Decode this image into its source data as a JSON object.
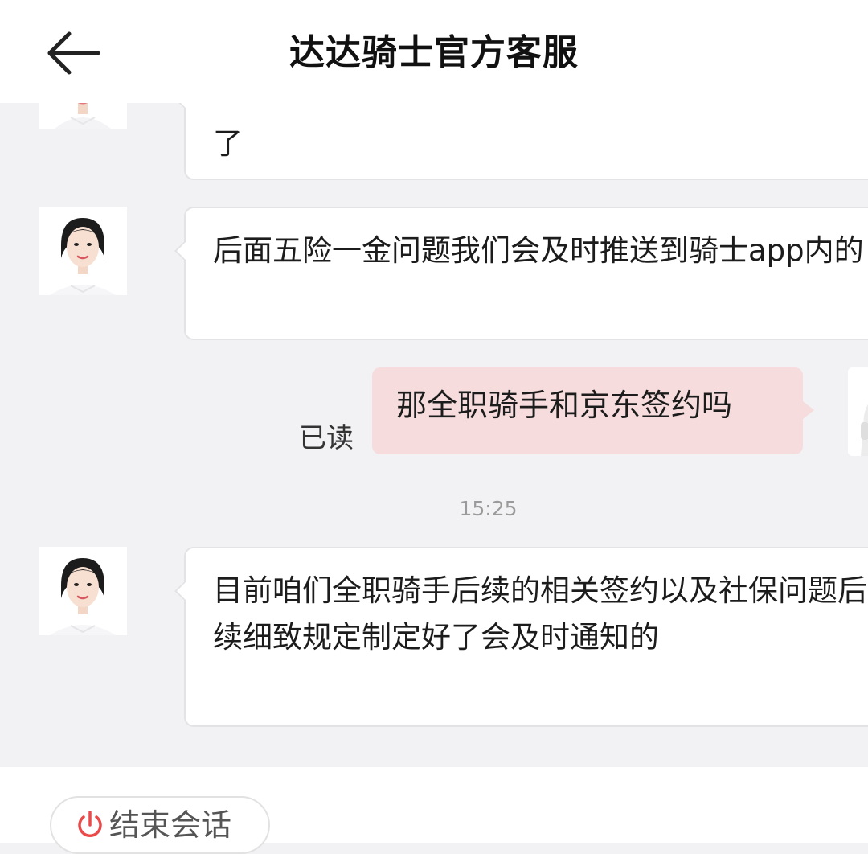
{
  "header": {
    "title": "达达骑士官方客服",
    "back_icon": "arrow-left-icon"
  },
  "messages": [
    {
      "from": "agent",
      "text": "了"
    },
    {
      "from": "agent",
      "text": "后面五险一金问题我们会及时推送到骑士app内的"
    },
    {
      "from": "user",
      "text": "那全职骑手和京东签约吗",
      "status": "已读"
    },
    {
      "from": "system",
      "text": "15:25"
    },
    {
      "from": "agent",
      "text": "目前咱们全职骑手后续的相关签约以及社保问题后续细致规定制定好了会及时通知的"
    }
  ],
  "footer": {
    "end_session_label": "结束会话",
    "end_session_icon": "power-icon",
    "end_session_icon_color": "#e94b4b"
  },
  "colors": {
    "background": "#f2f2f4",
    "agent_bubble": "#ffffff",
    "user_bubble": "#f6dcdc",
    "timestamp": "#9a9a9a"
  }
}
